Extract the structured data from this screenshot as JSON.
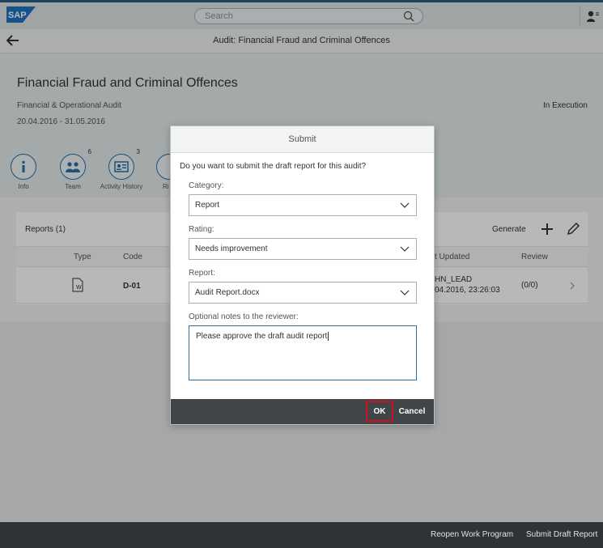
{
  "shell": {
    "search_placeholder": "Search"
  },
  "subheader": {
    "title": "Audit: Financial Fraud and Criminal Offences"
  },
  "object": {
    "title": "Financial Fraud and Criminal Offences",
    "subtitle": "Financial & Operational Audit",
    "date_range": "20.04.2016 - 31.05.2016",
    "status": "In Execution",
    "icon_bar": [
      {
        "label": "Info",
        "count": ""
      },
      {
        "label": "Team",
        "count": "6"
      },
      {
        "label": "Activity History",
        "count": "3"
      },
      {
        "label": "Ri",
        "count": ""
      }
    ]
  },
  "reports": {
    "title": "Reports (1)",
    "generate_label": "Generate",
    "columns": [
      "Type",
      "Code",
      "t Updated",
      "Review"
    ],
    "rows": [
      {
        "code": "D-01",
        "updated_by": "HN_LEAD",
        "updated_on": "04.2016, 23:26:03",
        "review": "(0/0)"
      }
    ]
  },
  "dialog": {
    "title": "Submit",
    "question": "Do you want to submit the draft report for this audit?",
    "category_label": "Category:",
    "category_value": "Report",
    "rating_label": "Rating:",
    "rating_value": "Needs improvement",
    "report_label": "Report:",
    "report_value": "Audit Report.docx",
    "notes_label": "Optional notes to the reviewer:",
    "notes_value": "Please approve the draft audit report",
    "ok_label": "OK",
    "cancel_label": "Cancel"
  },
  "footer": {
    "reopen_label": "Reopen Work Program",
    "submit_label": "Submit Draft Report"
  },
  "colors": {
    "accent": "#2b6eaa",
    "highlight": "#d0101a",
    "footer_bg": "#2f3336"
  }
}
